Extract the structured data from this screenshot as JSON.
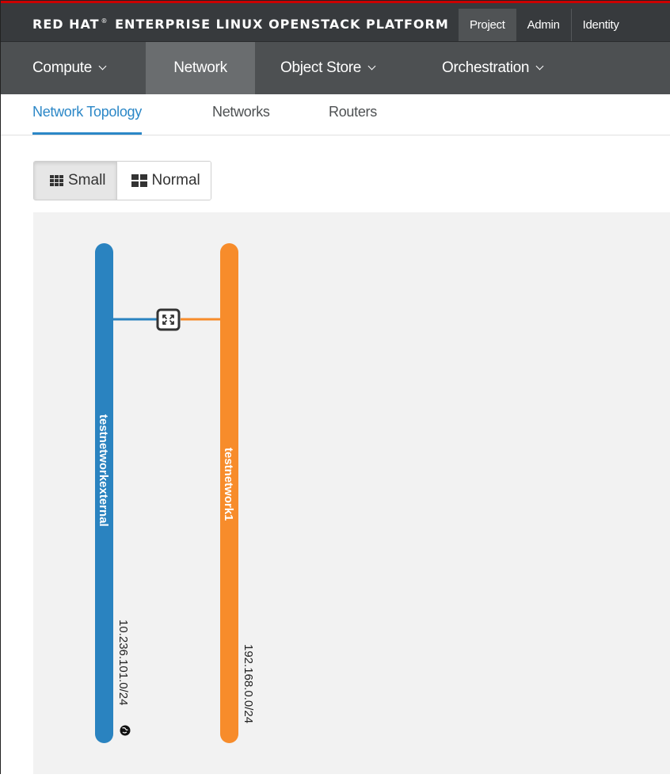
{
  "brand": {
    "text": "RED HAT",
    "mark": "®",
    "suffix": "ENTERPRISE LINUX OPENSTACK PLATFORM"
  },
  "top_tabs": [
    {
      "label": "Project",
      "active": true
    },
    {
      "label": "Admin",
      "active": false
    },
    {
      "label": "Identity",
      "active": false
    }
  ],
  "nav": [
    {
      "label": "Compute",
      "dropdown": true,
      "active": false
    },
    {
      "label": "Network",
      "dropdown": false,
      "active": true
    },
    {
      "label": "Object Store",
      "dropdown": true,
      "active": false
    },
    {
      "label": "Orchestration",
      "dropdown": true,
      "active": false
    }
  ],
  "sub_tabs": [
    {
      "label": "Network Topology",
      "active": true
    },
    {
      "label": "Networks",
      "active": false
    },
    {
      "label": "Routers",
      "active": false
    }
  ],
  "view_toggle": {
    "small": {
      "label": "Small",
      "icon": "th-icon",
      "active": true
    },
    "normal": {
      "label": "Normal",
      "icon": "th-large-icon",
      "active": false
    }
  },
  "topology": {
    "networks": [
      {
        "name": "testnetworkexternal",
        "cidr": "10.236.101.0/24",
        "color": "#2a83c0",
        "external": true,
        "external_icon": "globe-icon"
      },
      {
        "name": "testnetwork1",
        "cidr": "192.168.0.0/24",
        "color": "#f78c2b",
        "external": false
      }
    ],
    "router": {
      "icon": "router-icon",
      "connects": [
        "testnetworkexternal",
        "testnetwork1"
      ]
    }
  },
  "colors": {
    "brand_bar": "#373a3d",
    "nav_bar": "#4d5052",
    "accent": "#2b87c7",
    "canvas": "#f2f2f2"
  }
}
